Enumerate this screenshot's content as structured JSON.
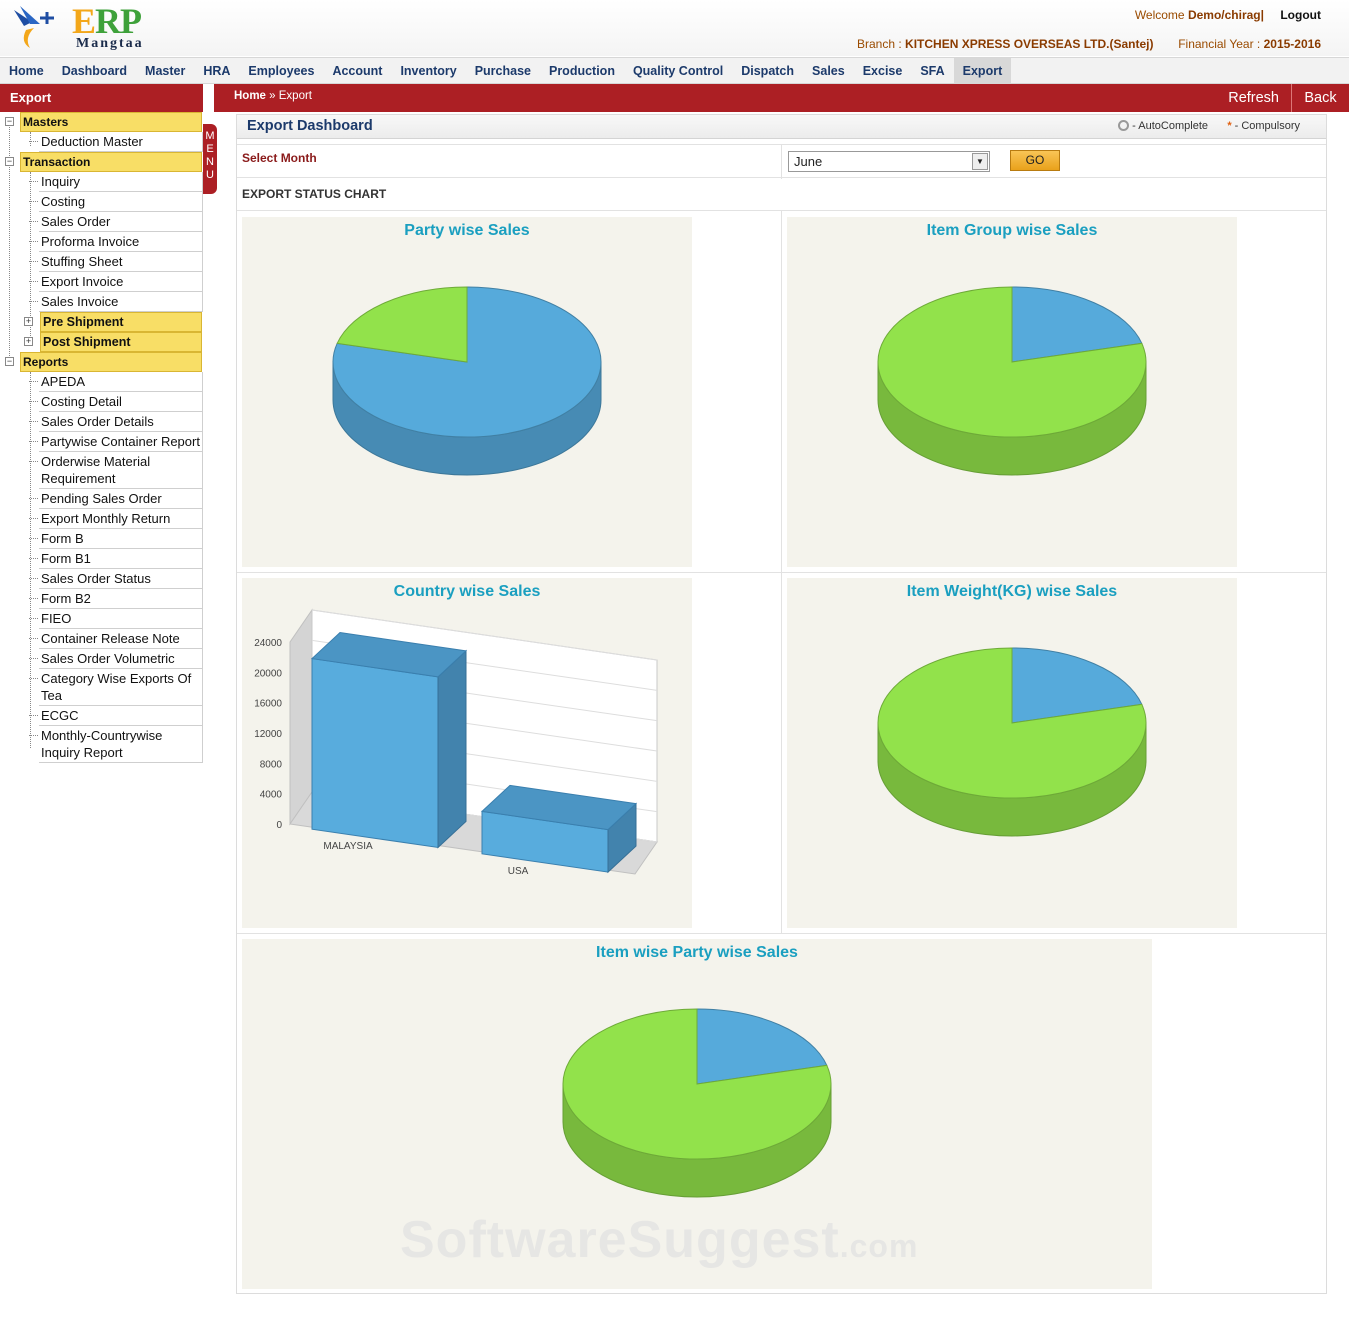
{
  "header": {
    "brand_main": "ERP",
    "brand_sub": "Mangtaa",
    "welcome_prefix": "Welcome",
    "user": "Demo/chirag|",
    "logout": "Logout",
    "branch_label": "Branch :",
    "branch": "KITCHEN XPRESS OVERSEAS LTD.(Santej)",
    "fy_label": "Financial Year :",
    "fy": "2015-2016"
  },
  "topnav": [
    "Home",
    "Dashboard",
    "Master",
    "HRA",
    "Employees",
    "Account",
    "Inventory",
    "Purchase",
    "Production",
    "Quality Control",
    "Dispatch",
    "Sales",
    "Excise",
    "SFA",
    "Export"
  ],
  "sidebar": {
    "title": "Export",
    "menu_tab": "MENU",
    "masters": {
      "label": "Masters",
      "items": [
        "Deduction Master"
      ]
    },
    "transaction": {
      "label": "Transaction",
      "items": [
        "Inquiry",
        "Costing",
        "Sales Order",
        "Proforma Invoice",
        "Stuffing Sheet",
        "Export Invoice",
        "Sales Invoice"
      ],
      "subsections": [
        "Pre Shipment",
        "Post Shipment"
      ]
    },
    "reports": {
      "label": "Reports",
      "items": [
        "APEDA",
        "Costing Detail",
        "Sales Order Details",
        "Partywise Container Report",
        "Orderwise Material Requirement",
        "Pending Sales Order",
        "Export Monthly Return",
        "Form B",
        "Form B1",
        "Sales Order Status",
        "Form B2",
        "FIEO",
        "Container Release Note",
        "Sales Order Volumetric",
        "Category Wise Exports Of Tea",
        "ECGC",
        "Monthly-Countrywise Inquiry Report"
      ]
    }
  },
  "content_bar": {
    "breadcrumb_home": "Home",
    "breadcrumb_current": "» Export",
    "refresh": "Refresh",
    "back": "Back"
  },
  "dashboard": {
    "title": "Export Dashboard",
    "legend_autocomplete": "- AutoComplete",
    "legend_compulsory": "- Compulsory",
    "legend_star": "*",
    "select_month_label": "Select Month",
    "selected_month": "June",
    "go": "GO",
    "status_heading": "EXPORT STATUS CHART"
  },
  "colors": {
    "blue": "#56aadb",
    "blue_dark": "#3f86b5",
    "green": "#92e24b",
    "green_dark": "#6fb631",
    "title": "#1a9fc0",
    "bar_red": "#ac1f24"
  },
  "chart_data": [
    {
      "type": "pie",
      "title": "Party wise Sales",
      "values": [
        79,
        21
      ],
      "colors": [
        "#56aadb",
        "#92e24b"
      ]
    },
    {
      "type": "pie",
      "title": "Item Group wise Sales",
      "values": [
        21,
        79
      ],
      "colors": [
        "#56aadb",
        "#92e24b"
      ]
    },
    {
      "type": "bar",
      "title": "Country wise Sales",
      "categories": [
        "MALAYSIA",
        "USA"
      ],
      "values": [
        22500,
        5600
      ],
      "yticks": [
        0,
        4000,
        8000,
        12000,
        16000,
        20000,
        24000
      ],
      "ylim": [
        0,
        24000
      ]
    },
    {
      "type": "pie",
      "title": "Item Weight(KG) wise Sales",
      "values": [
        21,
        79
      ],
      "colors": [
        "#56aadb",
        "#92e24b"
      ]
    },
    {
      "type": "pie",
      "title": "Item wise Party wise Sales",
      "values": [
        21,
        79
      ],
      "colors": [
        "#56aadb",
        "#92e24b"
      ]
    }
  ],
  "watermark": {
    "main": "SoftwareSuggest",
    "suffix": ".com"
  }
}
